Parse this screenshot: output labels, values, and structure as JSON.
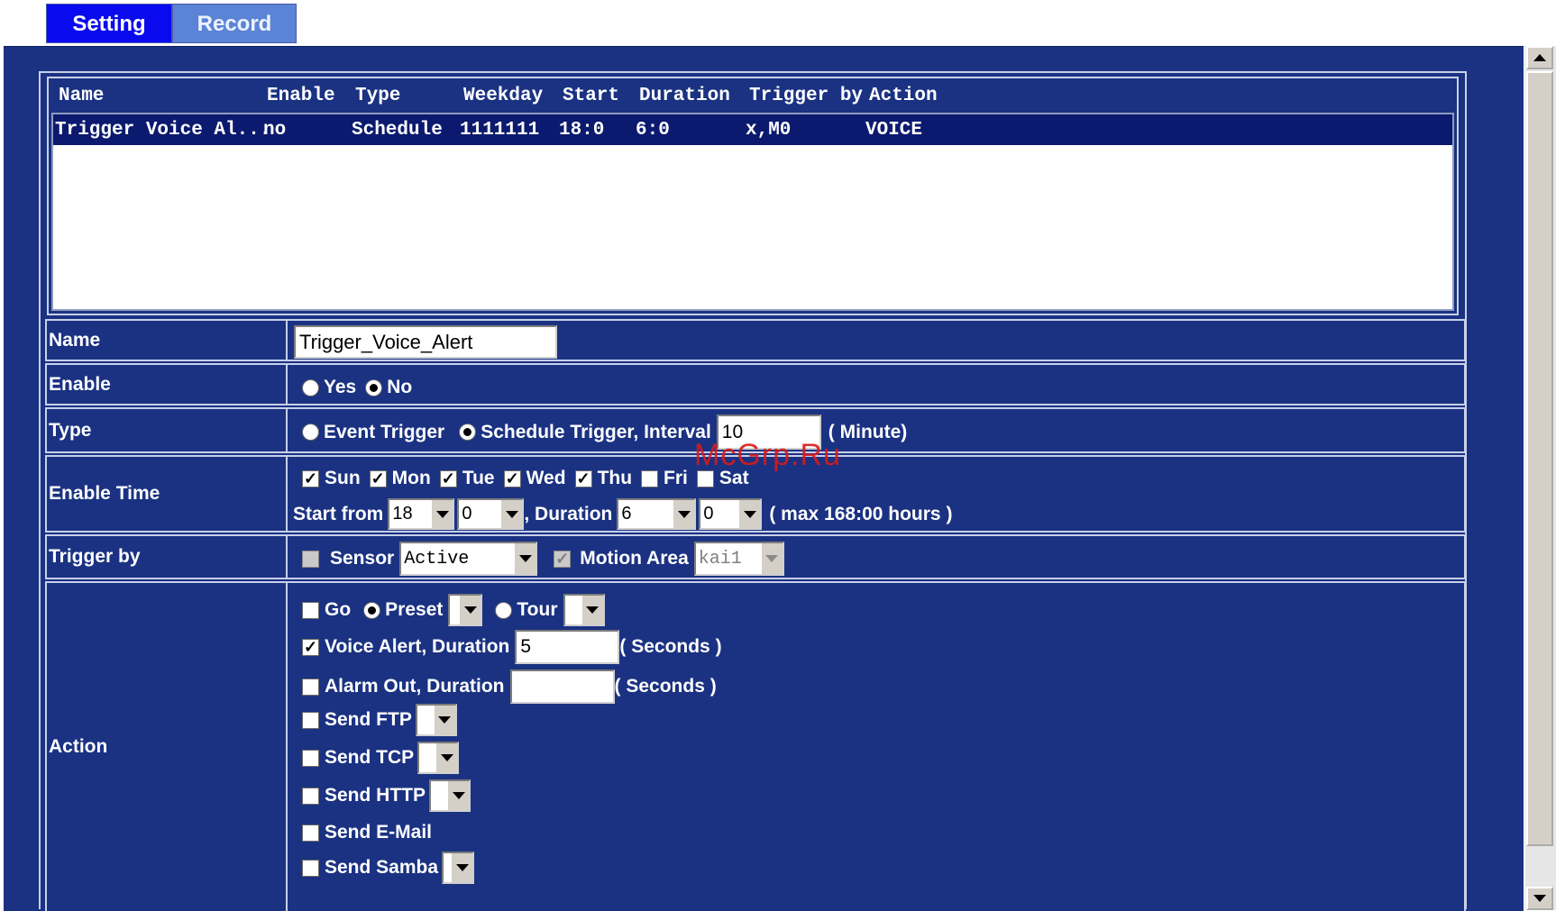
{
  "tabs": [
    {
      "label": "Setting",
      "active": true
    },
    {
      "label": "Record",
      "active": false
    }
  ],
  "schedule_list": {
    "columns": [
      "Name",
      "Enable",
      "Type",
      "Weekday",
      "Start",
      "Duration",
      "Trigger by",
      "Action"
    ],
    "rows": [
      {
        "name": "Trigger Voice Al...",
        "enable": "no",
        "type": "Schedule",
        "weekday": "1111111",
        "start": "18:0",
        "duration": "6:0",
        "trigger_by": "x,M0",
        "action": "VOICE",
        "selected": true
      }
    ]
  },
  "form": {
    "name": {
      "label": "Name",
      "value": "Trigger_Voice_Alert"
    },
    "enable": {
      "label": "Enable",
      "yes": "Yes",
      "no": "No",
      "selected": "No"
    },
    "type": {
      "label": "Type",
      "event": "Event Trigger",
      "schedule": "Schedule Trigger, Interval",
      "selected": "Schedule Trigger",
      "interval": "10",
      "unit": "( Minute)"
    },
    "enable_time": {
      "label": "Enable Time",
      "days": [
        {
          "label": "Sun",
          "checked": true
        },
        {
          "label": "Mon",
          "checked": true
        },
        {
          "label": "Tue",
          "checked": true
        },
        {
          "label": "Wed",
          "checked": true
        },
        {
          "label": "Thu",
          "checked": true
        },
        {
          "label": "Fri",
          "checked": false
        },
        {
          "label": "Sat",
          "checked": false
        }
      ],
      "start_label": "Start from",
      "start_hour": "18",
      "start_min": "0",
      "duration_label": ", Duration",
      "duration_hour": "6",
      "duration_min": "0",
      "max_note": "( max 168:00 hours )"
    },
    "trigger_by": {
      "label": "Trigger by",
      "sensor_label": "Sensor",
      "sensor_checked": false,
      "sensor_state": "Active",
      "motion_label": "Motion Area",
      "motion_checked": true,
      "motion_area": "kai1"
    },
    "action": {
      "label": "Action",
      "go_label": "Go",
      "preset_label": "Preset",
      "tour_label": "Tour",
      "go_mode": "Preset",
      "voice_label": "Voice Alert, Duration",
      "voice_checked": true,
      "voice_duration": "5",
      "seconds": "( Seconds )",
      "alarm_label": "Alarm Out, Duration",
      "alarm_duration": "",
      "send_ftp": "Send FTP",
      "send_tcp": "Send TCP",
      "send_http": "Send HTTP",
      "send_email": "Send E-Mail",
      "send_samba": "Send Samba"
    }
  },
  "watermark": "McGrp.Ru",
  "colors": {
    "panel_bg": "#1b3282",
    "active_tab": "#0a0aee",
    "inactive_tab": "#5b84d6",
    "selected_row": "#0b1a6e"
  }
}
